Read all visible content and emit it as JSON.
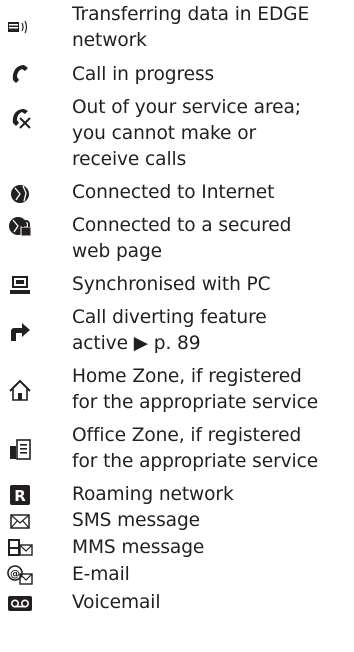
{
  "icons": [
    {
      "icon": "edge-transfer-icon",
      "lines": [
        "Transferring data in EDGE",
        "network"
      ]
    },
    {
      "icon": "call-in-progress-icon",
      "lines": [
        "Call in progress"
      ]
    },
    {
      "icon": "no-service-icon",
      "lines": [
        "Out of your service area;",
        "you cannot make or",
        "receive calls"
      ]
    },
    {
      "icon": "internet-icon",
      "lines": [
        "Connected to Internet"
      ]
    },
    {
      "icon": "secure-web-icon",
      "lines": [
        "Connected to a secured",
        "web page"
      ]
    },
    {
      "icon": "pc-sync-icon",
      "lines": [
        "Synchronised with PC"
      ]
    },
    {
      "icon": "call-divert-icon",
      "lines": [
        "Call diverting feature",
        "active ▶ p. 89"
      ]
    },
    {
      "icon": "home-zone-icon",
      "lines": [
        "Home Zone, if registered",
        "for the appropriate service"
      ]
    },
    {
      "icon": "office-zone-icon",
      "lines": [
        "Office Zone, if registered",
        "for the appropriate service"
      ]
    },
    {
      "icon": "roaming-icon",
      "lines": [
        "Roaming network"
      ]
    },
    {
      "icon": "sms-icon",
      "lines": [
        "SMS message"
      ]
    },
    {
      "icon": "mms-icon",
      "lines": [
        "MMS message"
      ]
    },
    {
      "icon": "email-icon",
      "lines": [
        "E-mail"
      ]
    },
    {
      "icon": "voicemail-icon",
      "lines": [
        "Voicemail"
      ]
    }
  ]
}
